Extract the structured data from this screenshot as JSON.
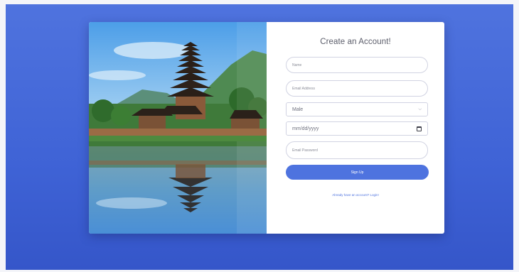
{
  "form": {
    "title": "Create an Account!",
    "name_placeholder": "Name",
    "email_placeholder": "Email Address",
    "gender_value": "Male",
    "date_placeholder": "mm/dd/yyyy",
    "password_placeholder": "Email Password",
    "submit_label": "Sign Up",
    "login_link": "Already have an account? Login!"
  },
  "icons": {
    "select_chevron": "chevron-down-icon",
    "date_picker": "calendar-icon"
  },
  "colors": {
    "background": "#4e73df",
    "primary": "#4e73df",
    "card": "#ffffff",
    "input_border": "#d1d3e2"
  }
}
